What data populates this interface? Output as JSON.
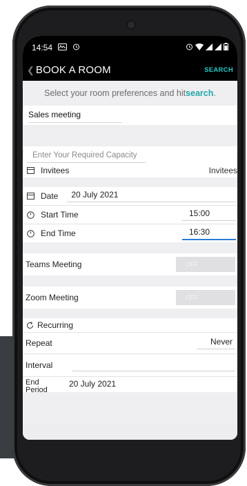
{
  "status": {
    "time": "14:54",
    "left_icons": [
      "cast-icon",
      "alarm-icon"
    ],
    "right_icons": [
      "alarm-icon",
      "wifi-icon",
      "signal-icon",
      "signal-icon",
      "battery-icon"
    ]
  },
  "app_bar": {
    "title": "BOOK A ROOM",
    "search_label": "SEARCH"
  },
  "hint": {
    "prefix": "Select your room preferences and hit ",
    "emphasis": "search",
    "suffix": "."
  },
  "meeting": {
    "name": "Sales meeting"
  },
  "capacity": {
    "placeholder": "Enter Your Required Capacity"
  },
  "invitees": {
    "label": "Invitees",
    "value": "Invitees"
  },
  "date": {
    "label": "Date",
    "value": "20 July 2021"
  },
  "start_time": {
    "label": "Start Time",
    "value": "15:00"
  },
  "end_time": {
    "label": "End Time",
    "value": "16:30"
  },
  "teams": {
    "label": "Teams Meeting",
    "toggle": "OFF"
  },
  "zoom": {
    "label": "Zoom Meeting",
    "toggle": "OFF"
  },
  "recurring": {
    "label": "Recurring"
  },
  "repeat": {
    "label": "Repeat",
    "value": "Never"
  },
  "interval": {
    "label": "Interval"
  },
  "end_period": {
    "label": "End Period",
    "value": "20 July 2021"
  },
  "colors": {
    "accent": "#26c6c6",
    "active_underline": "#2a7bd6",
    "background": "#efeff2"
  }
}
